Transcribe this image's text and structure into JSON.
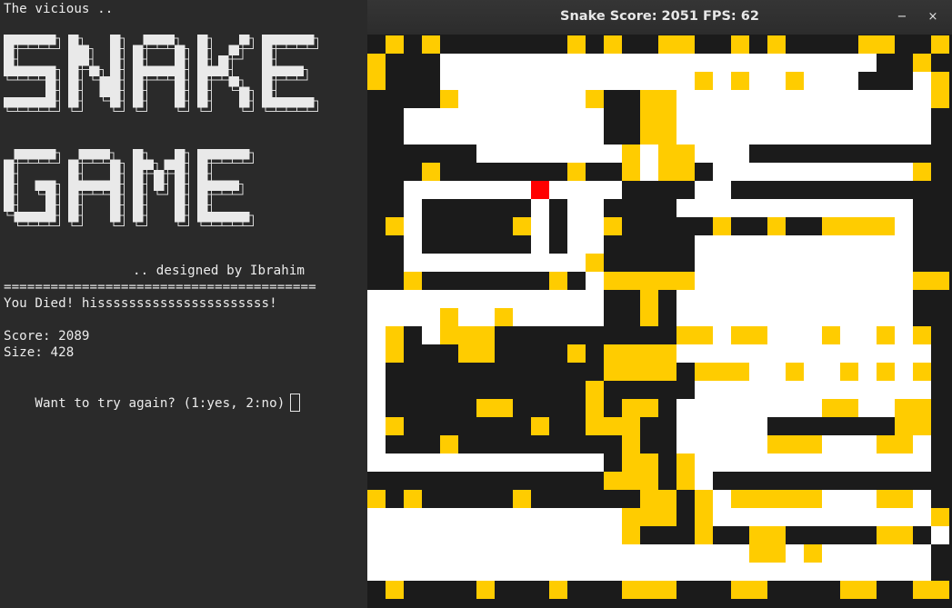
{
  "terminal": {
    "intro": "The vicious ..",
    "banner_line1": "SNAKE",
    "banner_line2": "GAME",
    "credit": ".. designed by Ibrahim",
    "separator": "========================================",
    "died_message": "You Died! hissssssssssssssssssssss!",
    "score_label": "Score: 2089",
    "size_label": "Size: 428",
    "prompt": "Want to try again? (1:yes, 2:no)"
  },
  "game_window": {
    "title": "Snake Score: 2051 FPS: 62",
    "minimize_label": "−",
    "close_label": "×"
  },
  "colors": {
    "terminal_bg": "#2a2a2a",
    "board_bg": "#1b1b1b",
    "snake_body": "#ffffff",
    "food": "#ffcc00",
    "snake_head": "#ff0000"
  },
  "board": {
    "cols": 32,
    "rows": 31,
    "head": [
      9,
      8
    ],
    "snake_rects": [
      [
        4,
        1,
        27,
        1
      ],
      [
        4,
        2,
        26,
        2
      ],
      [
        30,
        1,
        30,
        2
      ],
      [
        5,
        3,
        11,
        3
      ],
      [
        4,
        3,
        4,
        4
      ],
      [
        12,
        3,
        12,
        6
      ],
      [
        2,
        4,
        11,
        5
      ],
      [
        6,
        6,
        15,
        6
      ],
      [
        15,
        4,
        15,
        7
      ],
      [
        17,
        3,
        30,
        5
      ],
      [
        17,
        6,
        20,
        6
      ],
      [
        19,
        7,
        30,
        7
      ],
      [
        18,
        8,
        19,
        8
      ],
      [
        2,
        8,
        13,
        8
      ],
      [
        2,
        9,
        2,
        12
      ],
      [
        3,
        12,
        11,
        12
      ],
      [
        9,
        9,
        9,
        11
      ],
      [
        11,
        9,
        11,
        12
      ],
      [
        12,
        8,
        12,
        13
      ],
      [
        0,
        14,
        12,
        15
      ],
      [
        0,
        15,
        0,
        23
      ],
      [
        1,
        23,
        12,
        23
      ],
      [
        3,
        15,
        3,
        16
      ],
      [
        17,
        9,
        29,
        9
      ],
      [
        29,
        10,
        29,
        16
      ],
      [
        18,
        11,
        28,
        14
      ],
      [
        17,
        14,
        28,
        16
      ],
      [
        17,
        17,
        30,
        17
      ],
      [
        30,
        17,
        30,
        19
      ],
      [
        18,
        18,
        29,
        20
      ],
      [
        17,
        20,
        18,
        24
      ],
      [
        19,
        22,
        30,
        23
      ],
      [
        18,
        25,
        30,
        26
      ],
      [
        0,
        26,
        13,
        26
      ],
      [
        0,
        27,
        13,
        29
      ],
      [
        14,
        28,
        30,
        29
      ],
      [
        31,
        26,
        31,
        27
      ],
      [
        19,
        21,
        21,
        21
      ],
      [
        22,
        13,
        28,
        13
      ]
    ],
    "food_rects": [
      [
        1,
        0,
        1,
        0
      ],
      [
        3,
        0,
        3,
        0
      ],
      [
        11,
        0,
        11,
        0
      ],
      [
        13,
        0,
        13,
        0
      ],
      [
        16,
        0,
        17,
        0
      ],
      [
        20,
        0,
        20,
        0
      ],
      [
        22,
        0,
        22,
        0
      ],
      [
        27,
        0,
        28,
        0
      ],
      [
        31,
        0,
        31,
        0
      ],
      [
        0,
        1,
        0,
        2
      ],
      [
        30,
        1,
        30,
        1
      ],
      [
        31,
        2,
        31,
        3
      ],
      [
        4,
        3,
        4,
        3
      ],
      [
        12,
        3,
        12,
        3
      ],
      [
        15,
        3,
        16,
        3
      ],
      [
        18,
        2,
        18,
        2
      ],
      [
        20,
        2,
        20,
        2
      ],
      [
        23,
        2,
        23,
        2
      ],
      [
        15,
        4,
        16,
        5
      ],
      [
        16,
        6,
        17,
        7
      ],
      [
        14,
        6,
        14,
        7
      ],
      [
        3,
        7,
        3,
        7
      ],
      [
        11,
        7,
        11,
        7
      ],
      [
        30,
        7,
        30,
        7
      ],
      [
        1,
        10,
        1,
        10
      ],
      [
        8,
        10,
        8,
        10
      ],
      [
        13,
        10,
        13,
        10
      ],
      [
        19,
        10,
        19,
        10
      ],
      [
        22,
        10,
        22,
        10
      ],
      [
        25,
        10,
        28,
        10
      ],
      [
        12,
        12,
        12,
        12
      ],
      [
        13,
        13,
        17,
        13
      ],
      [
        15,
        14,
        15,
        15
      ],
      [
        2,
        13,
        2,
        13
      ],
      [
        10,
        13,
        10,
        13
      ],
      [
        30,
        13,
        31,
        13
      ],
      [
        4,
        15,
        4,
        16
      ],
      [
        7,
        15,
        7,
        15
      ],
      [
        5,
        16,
        6,
        17
      ],
      [
        1,
        16,
        1,
        17
      ],
      [
        11,
        17,
        11,
        17
      ],
      [
        13,
        17,
        16,
        18
      ],
      [
        17,
        16,
        18,
        16
      ],
      [
        20,
        16,
        21,
        16
      ],
      [
        25,
        16,
        25,
        16
      ],
      [
        28,
        16,
        28,
        16
      ],
      [
        30,
        16,
        30,
        16
      ],
      [
        18,
        18,
        20,
        18
      ],
      [
        23,
        18,
        23,
        18
      ],
      [
        26,
        18,
        26,
        18
      ],
      [
        28,
        18,
        28,
        18
      ],
      [
        30,
        18,
        30,
        18
      ],
      [
        12,
        19,
        12,
        21
      ],
      [
        6,
        20,
        7,
        20
      ],
      [
        14,
        20,
        15,
        20
      ],
      [
        25,
        20,
        26,
        20
      ],
      [
        1,
        21,
        1,
        21
      ],
      [
        9,
        21,
        9,
        21
      ],
      [
        13,
        21,
        14,
        21
      ],
      [
        29,
        20,
        30,
        21
      ],
      [
        4,
        22,
        4,
        22
      ],
      [
        14,
        22,
        14,
        23
      ],
      [
        22,
        22,
        24,
        22
      ],
      [
        28,
        22,
        29,
        22
      ],
      [
        15,
        23,
        15,
        26
      ],
      [
        17,
        23,
        17,
        24
      ],
      [
        13,
        24,
        14,
        24
      ],
      [
        0,
        25,
        0,
        25
      ],
      [
        2,
        25,
        2,
        25
      ],
      [
        8,
        25,
        8,
        25
      ],
      [
        16,
        25,
        16,
        26
      ],
      [
        18,
        25,
        18,
        25
      ],
      [
        20,
        25,
        24,
        25
      ],
      [
        28,
        25,
        29,
        25
      ],
      [
        14,
        26,
        14,
        27
      ],
      [
        18,
        26,
        18,
        27
      ],
      [
        21,
        27,
        22,
        28
      ],
      [
        28,
        27,
        29,
        27
      ],
      [
        31,
        26,
        31,
        26
      ],
      [
        22,
        28,
        22,
        28
      ],
      [
        24,
        28,
        24,
        28
      ],
      [
        1,
        30,
        1,
        30
      ],
      [
        6,
        30,
        6,
        30
      ],
      [
        10,
        30,
        10,
        30
      ],
      [
        14,
        30,
        16,
        30
      ],
      [
        20,
        30,
        21,
        30
      ],
      [
        26,
        30,
        27,
        30
      ],
      [
        30,
        30,
        31,
        30
      ]
    ]
  }
}
